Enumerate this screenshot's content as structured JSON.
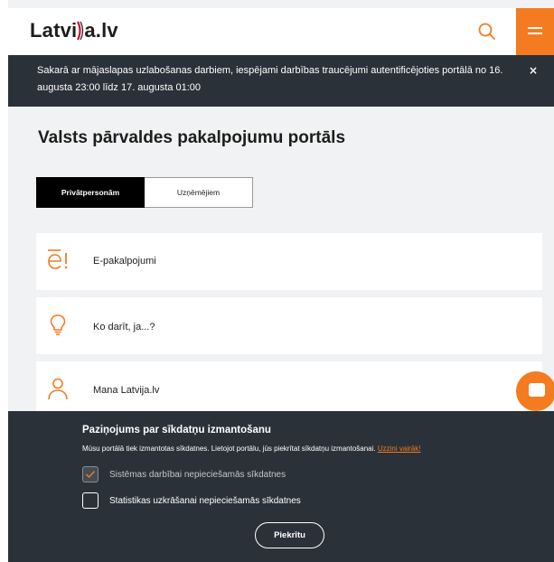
{
  "header": {
    "logo_left": "Latvi",
    "logo_right": "a.lv"
  },
  "notice": {
    "text": "Sakarā ar mājaslapas uzlabošanas darbiem, iespējami darbības traucējumi autentificējoties portālā no 16. augusta 23:00 līdz 17. augusta 01:00",
    "close": "×"
  },
  "page": {
    "title": "Valsts pārvaldes pakalpojumu portāls"
  },
  "tabs": [
    {
      "label": "Privātpersonām",
      "active": true
    },
    {
      "label": "Uzņēmējiem",
      "active": false
    }
  ],
  "cards": [
    {
      "label": "E-pakalpojumi",
      "icon": "e-services-icon"
    },
    {
      "label": "Ko darīt, ja...?",
      "icon": "lightbulb-icon"
    },
    {
      "label": "Mana Latvija.lv",
      "icon": "user-icon"
    }
  ],
  "cookie": {
    "title": "Paziņojums par sīkdatņu izmantošanu",
    "text": "Mūsu portālā tiek izmantotas sīkdatnes. Lietojot portālu, jūs piekrītat sīkdatņu izmantošanai.",
    "link": "Uzzini vairāk!",
    "options": [
      {
        "label": "Sistēmas darbībai nepieciešamās sīkdatnes",
        "checked": true
      },
      {
        "label": "Statistikas uzkrāšanai nepieciešamās sīkdatnes",
        "checked": false
      }
    ],
    "accept": "Piekrītu"
  },
  "colors": {
    "accent": "#f47b20",
    "dark": "#2b3138"
  }
}
